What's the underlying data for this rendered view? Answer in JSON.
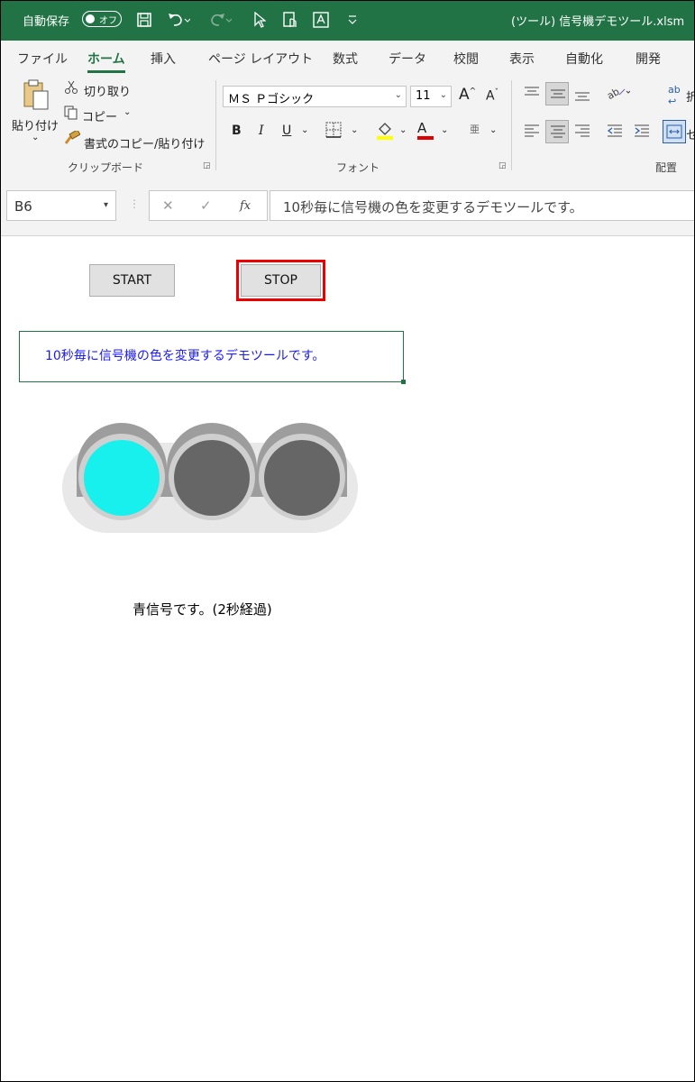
{
  "titlebar": {
    "autosave_label": "自動保存",
    "autosave_state": "オフ",
    "doc_title": "(ツール) 信号機デモツール.xlsm",
    "icons": [
      "save-icon",
      "undo-icon",
      "redo-icon",
      "pointer-icon",
      "touch-icon",
      "textbox-icon",
      "customize-icon"
    ]
  },
  "tabs": [
    "ファイル",
    "ホーム",
    "挿入",
    "ページ レイアウト",
    "数式",
    "データ",
    "校閲",
    "表示",
    "自動化",
    "開発"
  ],
  "ribbon": {
    "paste": "貼り付け",
    "cut": "切り取り",
    "copy": "コピー",
    "format_painter": "書式のコピー/貼り付け",
    "clipboard_group": "クリップボード",
    "font_name": "ＭＳ Ｐゴシック",
    "font_size": "11",
    "increase_font": "A",
    "decrease_font": "A",
    "bold": "B",
    "italic": "I",
    "underline": "U",
    "font_color": "A",
    "phonetic": "亜",
    "font_group": "フォント",
    "wrap_partial": "折",
    "merge_partial": "セ",
    "alignment_group": "配置"
  },
  "formula_bar": {
    "name_box": "B6",
    "cancel": "✕",
    "enter": "✓",
    "fx": "fx",
    "content": "10秒毎に信号機の色を変更するデモツールです。"
  },
  "sheet": {
    "start_button": "START",
    "stop_button": "STOP",
    "description": "10秒毎に信号機の色を変更するデモツールです。",
    "status_text": "青信号です。(2秒経過)"
  },
  "signal": {
    "active_light": "blue",
    "colors": {
      "active": "#18f0ee",
      "inactive": "#666666",
      "visor": "#9d9d9d",
      "rim": "#cfcfcf",
      "body": "#e8e8e8"
    }
  }
}
